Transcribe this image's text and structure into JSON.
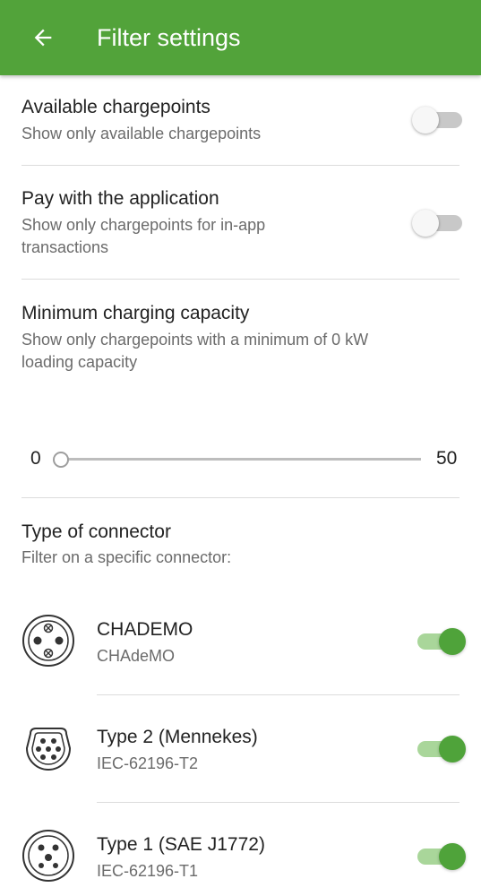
{
  "header": {
    "title": "Filter settings",
    "back_icon": "arrow-left-icon",
    "color": "#52a33a"
  },
  "filters": {
    "available": {
      "title": "Available chargepoints",
      "subtitle": "Show only available chargepoints",
      "enabled": false
    },
    "pay_app": {
      "title": "Pay with the application",
      "subtitle_line1": "Show only chargepoints for in-app",
      "subtitle_line2": "transactions",
      "enabled": false
    },
    "capacity": {
      "title": "Minimum charging capacity",
      "subtitle_line1": "Show only chargepoints with a minimum of 0 kW",
      "subtitle_line2": "loading capacity",
      "min_label": "0",
      "max_label": "50",
      "value": 0
    }
  },
  "connectors": {
    "title": "Type of connector",
    "subtitle": "Filter on a specific connector:",
    "items": [
      {
        "name": "CHADEMO",
        "code": "CHAdeMO",
        "icon": "chademo-connector-icon",
        "enabled": true
      },
      {
        "name": "Type 2 (Mennekes)",
        "code": "IEC-62196-T2",
        "icon": "type2-connector-icon",
        "enabled": true
      },
      {
        "name": "Type 1 (SAE J1772)",
        "code": "IEC-62196-T1",
        "icon": "type1-connector-icon",
        "enabled": true
      }
    ]
  },
  "colors": {
    "accent": "#4fa33a",
    "track_on": "#a9d69a",
    "track_off": "#c8c8c8"
  }
}
